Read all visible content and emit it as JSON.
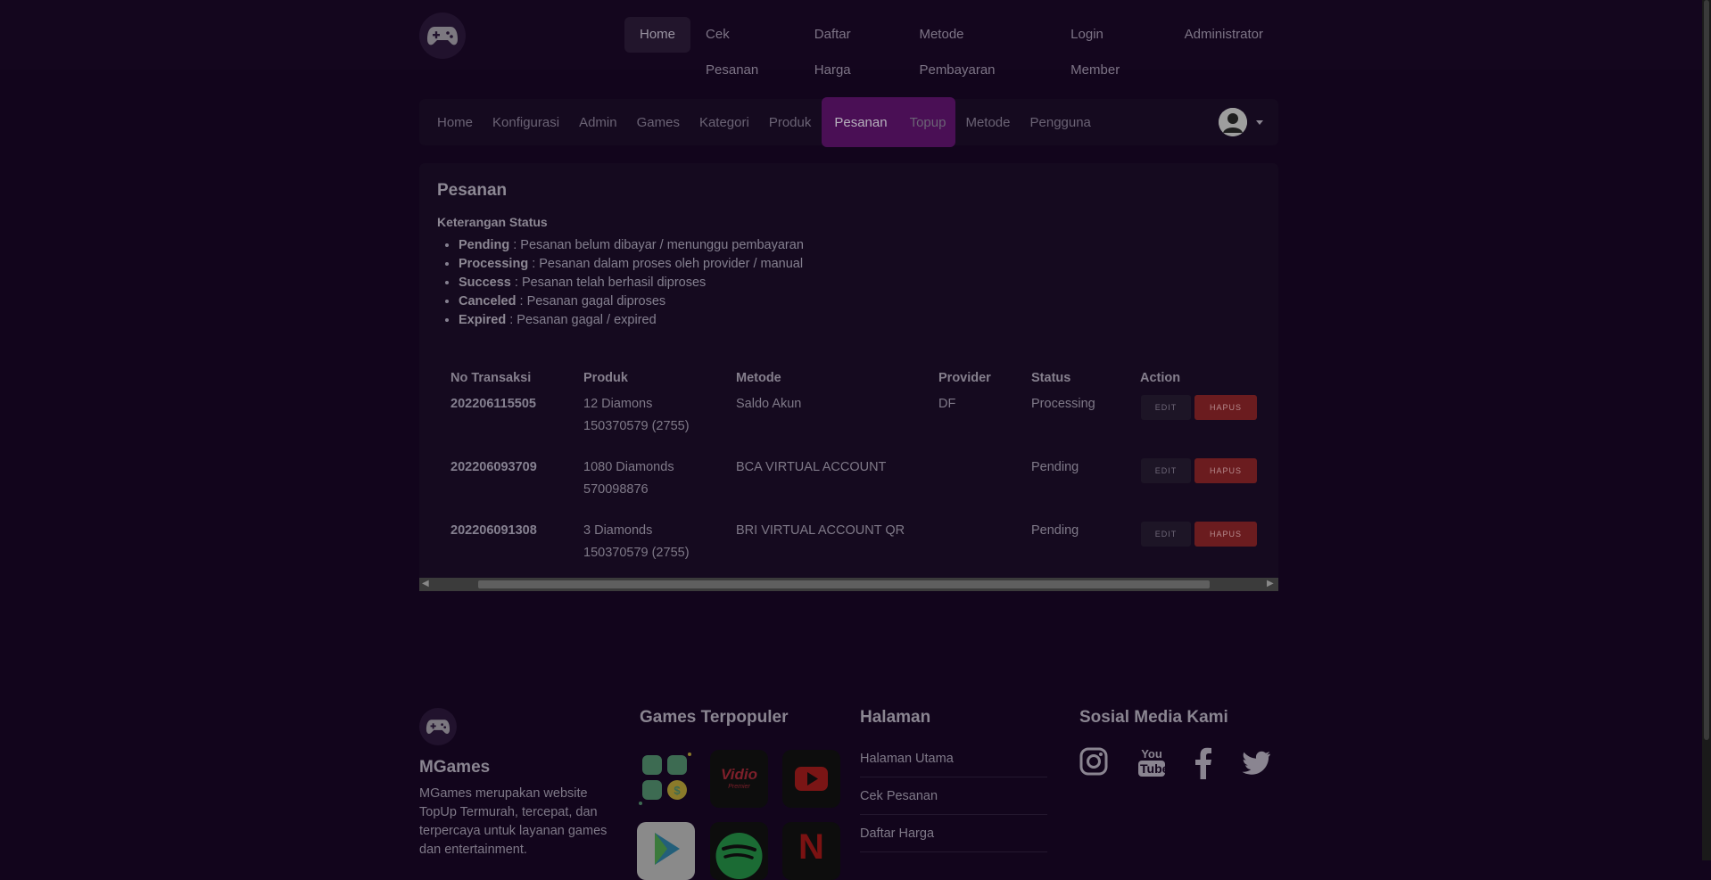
{
  "top_nav": {
    "items": [
      "Home",
      "Cek Pesanan",
      "Daftar Harga",
      "Metode Pembayaran",
      "Login Member",
      "Administrator"
    ],
    "active": "Home"
  },
  "admin_nav": {
    "items": [
      "Home",
      "Konfigurasi",
      "Admin",
      "Games",
      "Kategori",
      "Produk",
      "Pesanan",
      "Topup",
      "Metode",
      "Pengguna"
    ],
    "active": "Pesanan"
  },
  "page": {
    "title": "Pesanan",
    "status_title": "Keterangan Status",
    "statuses": [
      {
        "name": "Pending",
        "desc": " : Pesanan belum dibayar / menunggu pembayaran"
      },
      {
        "name": "Processing",
        "desc": " : Pesanan dalam proses oleh provider / manual"
      },
      {
        "name": "Success",
        "desc": " : Pesanan telah berhasil diproses"
      },
      {
        "name": "Canceled",
        "desc": " : Pesanan gagal diproses"
      },
      {
        "name": "Expired",
        "desc": " : Pesanan gagal / expired"
      }
    ]
  },
  "table": {
    "headers": [
      "No Transaksi",
      "Produk",
      "Metode",
      "Provider",
      "Status",
      "Action"
    ],
    "rows": [
      {
        "no": "202206115505",
        "produk": "12 Diamons",
        "target": "150370579 (2755)",
        "metode": "Saldo Akun",
        "provider": "DF",
        "status": "Processing"
      },
      {
        "no": "202206093709",
        "produk": "1080 Diamonds",
        "target": "570098876",
        "metode": "BCA VIRTUAL ACCOUNT",
        "provider": "",
        "status": "Pending"
      },
      {
        "no": "202206091308",
        "produk": "3 Diamonds",
        "target": "150370579 (2755)",
        "metode": "BRI VIRTUAL ACCOUNT QR",
        "provider": "",
        "status": "Pending"
      }
    ],
    "edit_label": "EDIT",
    "hapus_label": "HAPUS"
  },
  "footer": {
    "brand": "MGames",
    "description": "MGames merupakan website TopUp Termurah, tercepat, dan terpercaya untuk layanan games dan entertainment.",
    "games_title": "Games Terpopuler",
    "pages_title": "Halaman",
    "pages": [
      "Halaman Utama",
      "Cek Pesanan",
      "Daftar Harga"
    ],
    "social_title": "Sosial Media Kami",
    "social": [
      "instagram-icon",
      "youtube-icon",
      "facebook-icon",
      "twitter-icon"
    ],
    "youtube_label_top": "You",
    "youtube_label_bottom": "Tube",
    "app_tiles": [
      "coins-app",
      "Vidio",
      "youtube",
      "play-app",
      "spotify",
      "netflix"
    ],
    "vidio_label": "Vidio",
    "vidio_sub": "Premier",
    "netflix_label": "N"
  },
  "colors": {
    "background": "#12051c",
    "accent": "#4a0f55",
    "danger": "#6b1c1f"
  }
}
